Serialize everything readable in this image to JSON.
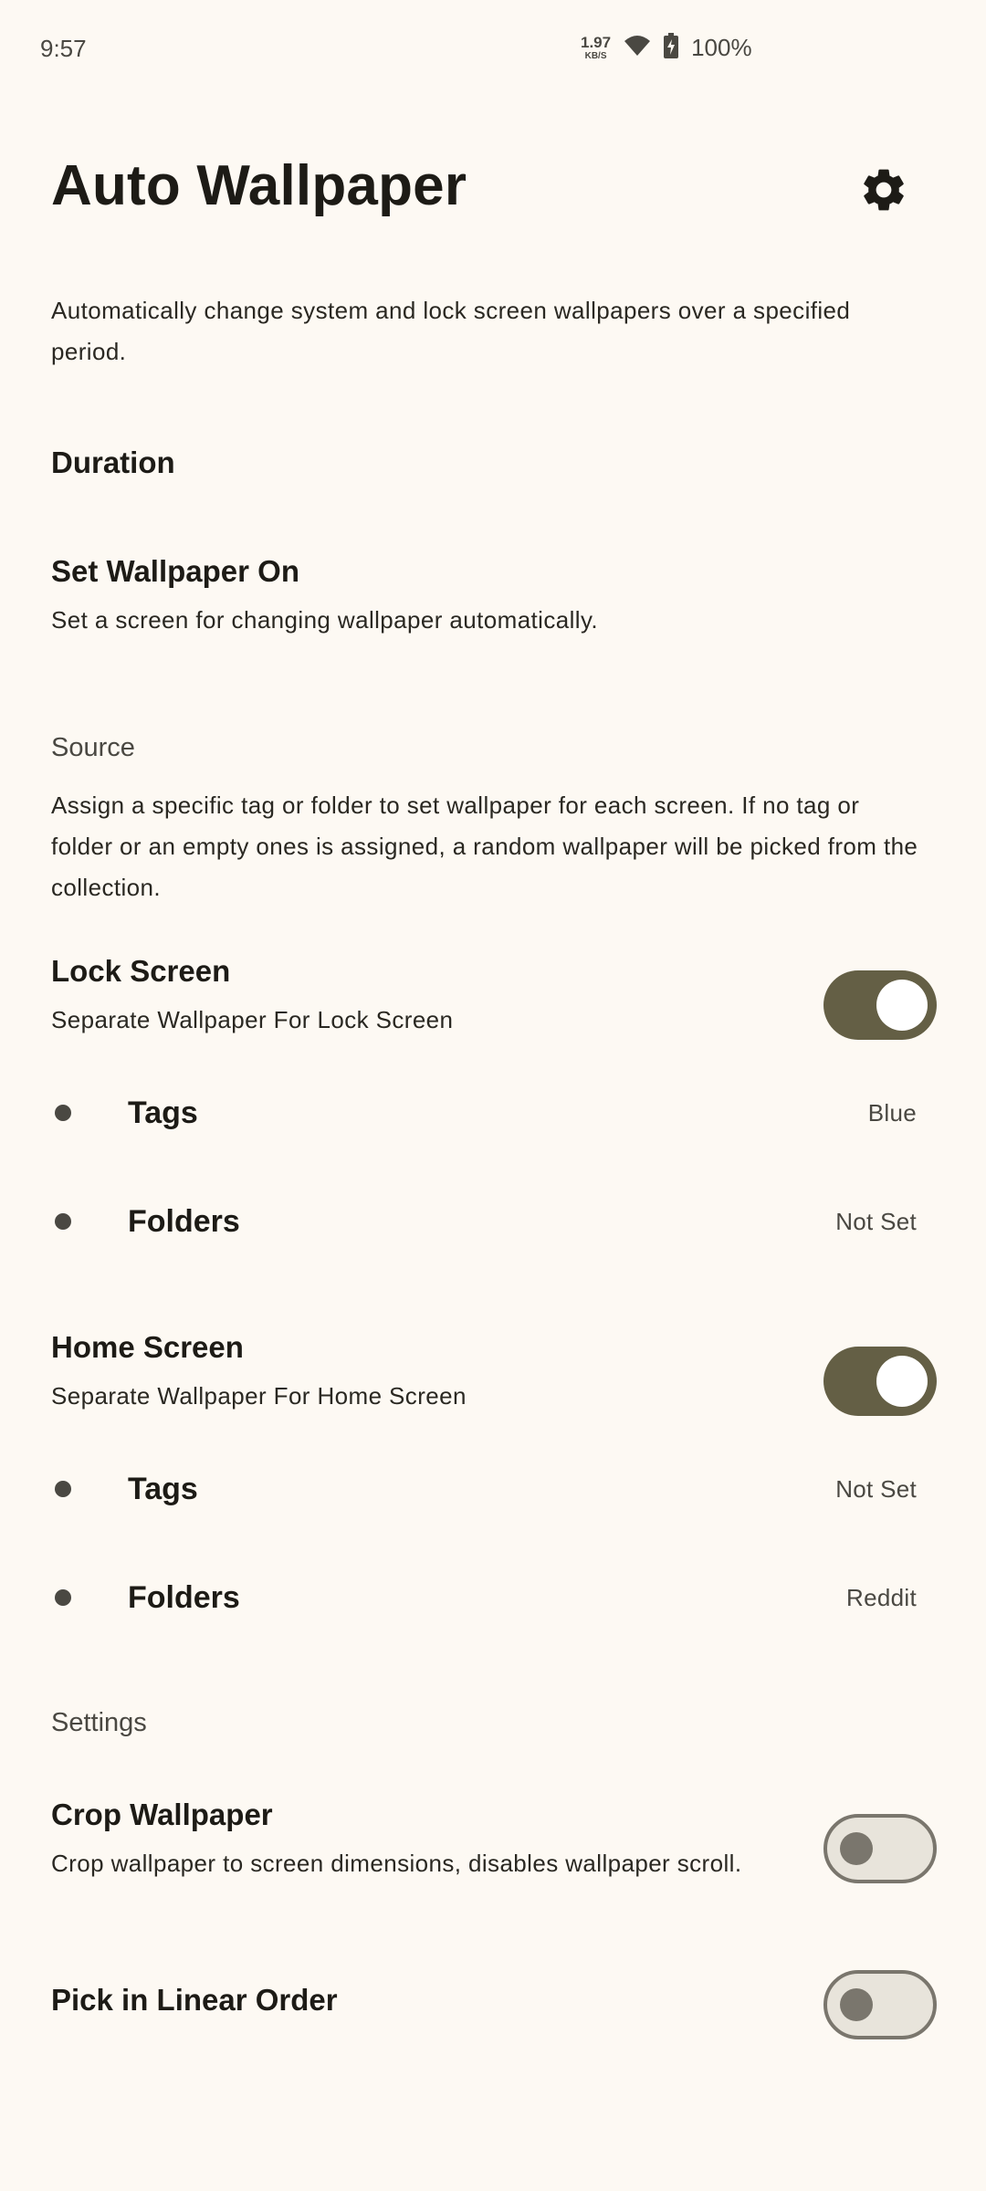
{
  "status_bar": {
    "time": "9:57",
    "net_speed_value": "1.97",
    "net_speed_unit": "KB/S",
    "wifi_icon": "wifi-icon",
    "battery_icon": "battery-charging-icon",
    "battery_percent": "100%"
  },
  "header": {
    "title": "Auto Wallpaper",
    "settings_icon": "gear-icon"
  },
  "description": "Automatically change system and lock screen wallpapers over a specified period.",
  "duration": {
    "title": "Duration"
  },
  "set_wallpaper_on": {
    "title": "Set Wallpaper On",
    "subtitle": "Set a screen for changing wallpaper automatically."
  },
  "source": {
    "header": "Source",
    "description": "Assign a specific tag or folder to set wallpaper for each screen. If no tag or folder or an empty ones is assigned, a random wallpaper will be picked from the collection."
  },
  "lock_screen": {
    "title": "Lock Screen",
    "subtitle": "Separate Wallpaper For Lock Screen",
    "enabled": true,
    "tags_label": "Tags",
    "tags_value": "Blue",
    "folders_label": "Folders",
    "folders_value": "Not Set"
  },
  "home_screen": {
    "title": "Home Screen",
    "subtitle": "Separate Wallpaper For Home Screen",
    "enabled": true,
    "tags_label": "Tags",
    "tags_value": "Not Set",
    "folders_label": "Folders",
    "folders_value": "Reddit"
  },
  "settings": {
    "header": "Settings",
    "crop_title": "Crop Wallpaper",
    "crop_subtitle": "Crop wallpaper to screen dimensions, disables wallpaper scroll.",
    "crop_enabled": false,
    "linear_title": "Pick in Linear Order",
    "linear_enabled": false
  },
  "colors": {
    "background": "#fdf9f3",
    "toggle_on_track": "#645f45",
    "toggle_off_track": "#e8e4db",
    "toggle_off_outline": "#7a766d"
  }
}
